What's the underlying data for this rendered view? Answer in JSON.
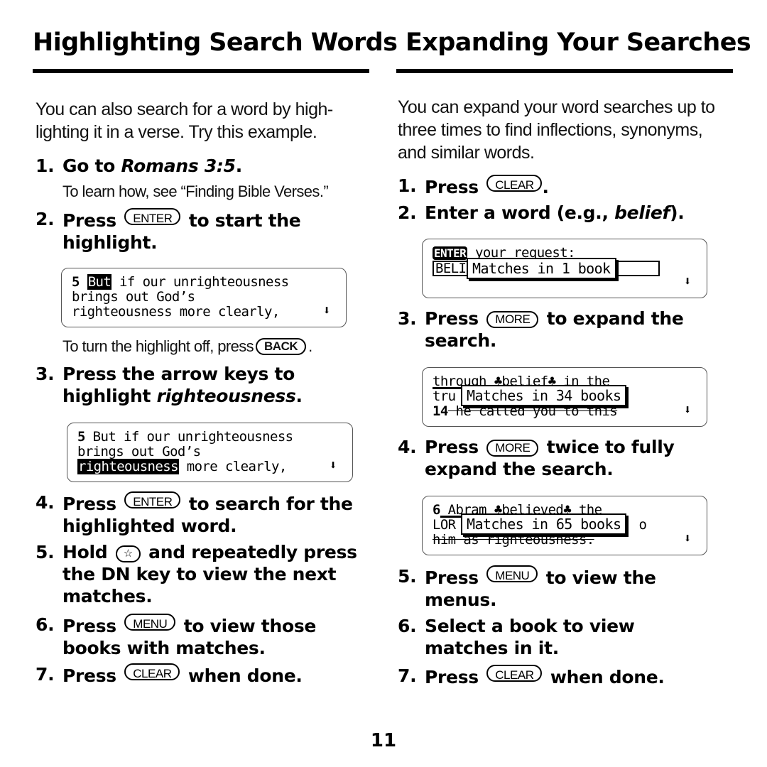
{
  "left": {
    "heading": "Highlighting Search Words",
    "intro": "You can also search for a word by high-lighting it in a verse. Try this example.",
    "steps": [
      {
        "num": "1.",
        "pre": "Go to ",
        "em": "Romans 3:5",
        "post": "."
      },
      {
        "num": "2.",
        "pre": "Press",
        "key": "ENTER",
        "post": "to start the highlight."
      },
      {
        "num": "3.",
        "pre": "Press the arrow keys to highlight ",
        "em": "righteousness",
        "post": "."
      },
      {
        "num": "4.",
        "pre": "Press",
        "key": "ENTER",
        "post": "to search for the highlighted word."
      },
      {
        "num": "5.",
        "pre": "Hold",
        "key": "☆",
        "post": "and repeatedly press the DN key to view the next matches."
      },
      {
        "num": "6.",
        "pre": "Press",
        "key": "MENU",
        "post": "to view those books with matches."
      },
      {
        "num": "7.",
        "pre": "Press",
        "key": "CLEAR",
        "post": "when done."
      }
    ],
    "note1": "To learn how, see “Finding Bible Verses.”",
    "note2_pre": "To turn the highlight off, press",
    "note2_key": "BACK",
    "note2_post": ".",
    "screen1": {
      "verse_num": "5",
      "highlight": "But",
      "line1_rest": " if our unrighteousness",
      "line2": "brings out God’s",
      "line3": "righteousness more clearly,",
      "scroll_icon": "down-arrow"
    },
    "screen2": {
      "verse_num": "5",
      "line1_rest": " But if our unrighteousness",
      "line2": "brings out God’s",
      "highlight": "righteousness",
      "line3_rest": " more clearly,",
      "scroll_icon": "down-arrow"
    }
  },
  "right": {
    "heading": "Expanding Your Searches",
    "intro": "You can expand your word searches up to three times to find inflections, synonyms, and similar words.",
    "steps": [
      {
        "num": "1.",
        "pre": "Press",
        "key": "CLEAR",
        "post": "."
      },
      {
        "num": "2.",
        "pre": "Enter a word (e.g., ",
        "em": "belief",
        "post": ")."
      },
      {
        "num": "3.",
        "pre": "Press",
        "key": "MORE",
        "post": "to expand the search."
      },
      {
        "num": "4.",
        "pre": "Press",
        "key": "MORE",
        "post": "twice to fully expand the search."
      },
      {
        "num": "5.",
        "pre": "Press",
        "key": "MENU",
        "post": "to view the menus."
      },
      {
        "num": "6.",
        "pre": "Select a book to view matches in it."
      },
      {
        "num": "7.",
        "pre": "Press",
        "key": "CLEAR",
        "post": "when done."
      }
    ],
    "screen1": {
      "tag": "ENTER",
      "line1_rest": " your request:",
      "input_value": "BELI",
      "popup": "Matches in 1 book"
    },
    "screen2": {
      "line1": "through ♣belief♣ in the",
      "line2_start": "tru",
      "line3_num": "14",
      "line3_rest": " he called you to this",
      "popup": "Matches in 34 books"
    },
    "screen3": {
      "line1_num": "6",
      "line1_rest": " Abram ♣believed♣ the",
      "line2_start": "LOR",
      "line2_end": "o",
      "line3": "him as righteousness.",
      "popup": "Matches in 65 books"
    }
  },
  "page_number": "11"
}
